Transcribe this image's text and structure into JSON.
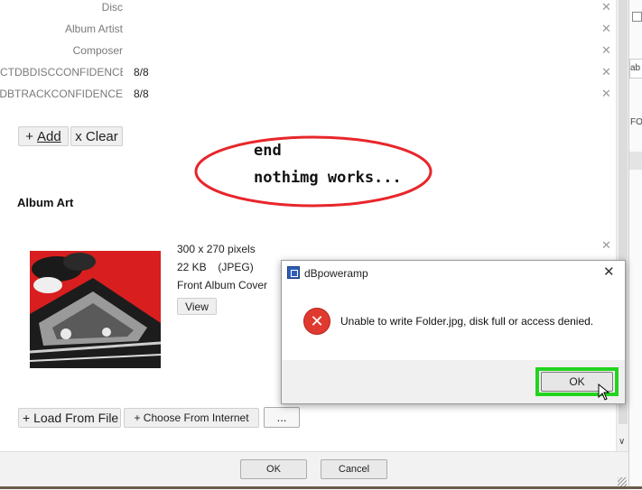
{
  "tags": [
    {
      "label": "Disc",
      "value": ""
    },
    {
      "label": "Album Artist",
      "value": ""
    },
    {
      "label": "Composer",
      "value": ""
    },
    {
      "label": "CTDBDISCCONFIDENCE",
      "value": "8/8"
    },
    {
      "label": "CTDBTRACKCONFIDENCE",
      "value": "8/8"
    }
  ],
  "tag_buttons": {
    "add_label": "Add",
    "add_prefix": "+",
    "clear_label": "x Clear"
  },
  "annotation": {
    "line1": "end",
    "line2": "nothimg works..."
  },
  "album_art": {
    "section_title": "Album Art",
    "dimensions": "300 x 270 pixels",
    "size": "22 KB",
    "format": "(JPEG)",
    "type": "Front Album Cover",
    "view_label": "View"
  },
  "art_buttons": {
    "load_label": "+ Load From File",
    "choose_label": "+ Choose From Internet",
    "more_label": "..."
  },
  "footer": {
    "ok_label": "OK",
    "cancel_label": "Cancel"
  },
  "dialog": {
    "title": "dBpoweramp",
    "message": "Unable to write Folder.jpg, disk full or access denied.",
    "ok_label": "OK"
  },
  "right_panel": {
    "partial_1": "ab",
    "partial_2": "FO"
  },
  "colors": {
    "annotation": "#e8262b",
    "highlight": "#22d41f",
    "error": "#e0392f"
  }
}
